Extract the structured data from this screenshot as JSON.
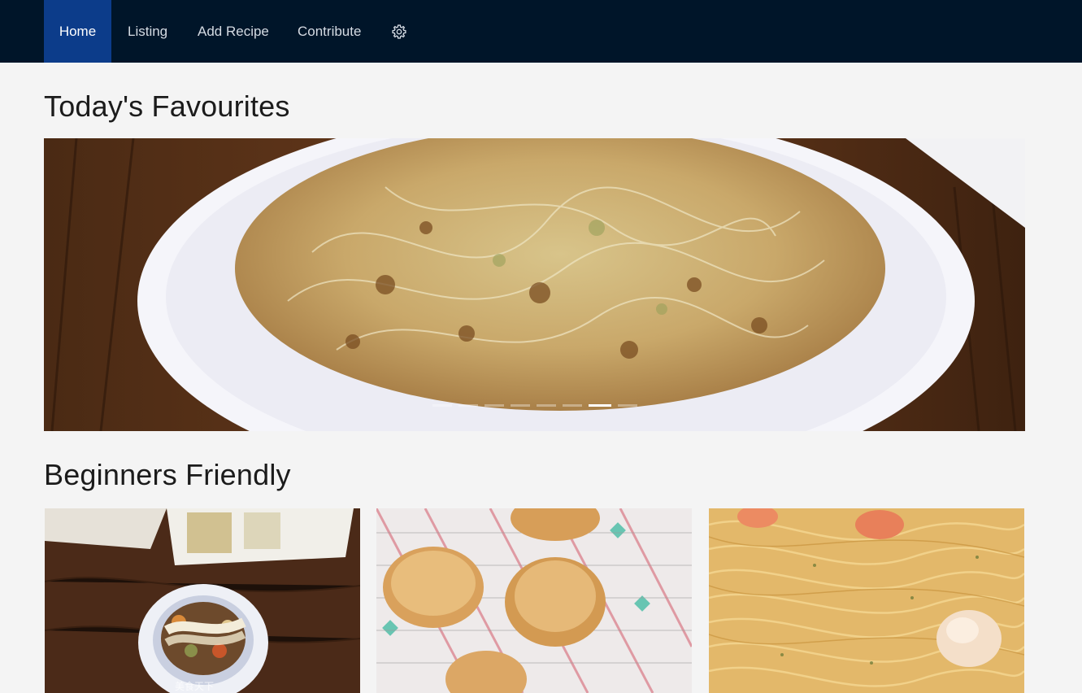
{
  "nav": {
    "items": [
      {
        "label": "Home",
        "active": true
      },
      {
        "label": "Listing"
      },
      {
        "label": "Add Recipe"
      },
      {
        "label": "Contribute"
      }
    ],
    "settings_icon": "gear-icon"
  },
  "favourites": {
    "title": "Today's Favourites",
    "slide_count": 8,
    "active_slide": 7
  },
  "beginners": {
    "title": "Beginners Friendly",
    "cards": [
      {
        "image": "stew-with-twisted-bread-bowl",
        "caption": "美食天下"
      },
      {
        "image": "baked-scones-on-cooling-rack"
      },
      {
        "image": "shrimp-spaghetti"
      }
    ]
  },
  "colors": {
    "nav_bg": "#001529",
    "nav_active": "#0c3c8a",
    "page_bg": "#f4f4f4"
  }
}
